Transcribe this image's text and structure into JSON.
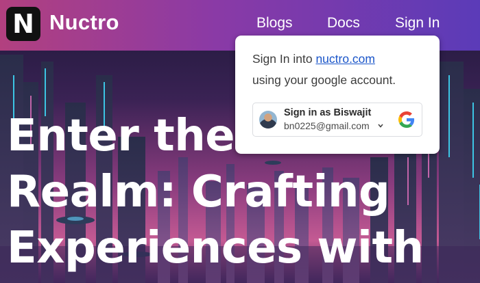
{
  "brand": {
    "logo_letter": "N",
    "name": "Nuctro"
  },
  "nav": {
    "blogs": "Blogs",
    "docs": "Docs",
    "sign_in": "Sign In"
  },
  "hero": {
    "lines": [
      "Enter the D",
      "Realm: Crafting",
      "Experiences with"
    ]
  },
  "signin_popup": {
    "line1_prefix": "Sign In into",
    "line1_link": "nuctro.com",
    "line2": "using your google account.",
    "account": {
      "name": "Sign in as Biswajit",
      "email": "bn0225@gmail.com"
    }
  },
  "colors": {
    "header_gradient": [
      "#b2407f",
      "#8a3aa6",
      "#5b3bb8"
    ],
    "link": "#1a55c9",
    "google": [
      "#4285F4",
      "#34A853",
      "#FBBC05",
      "#EA4335"
    ]
  }
}
